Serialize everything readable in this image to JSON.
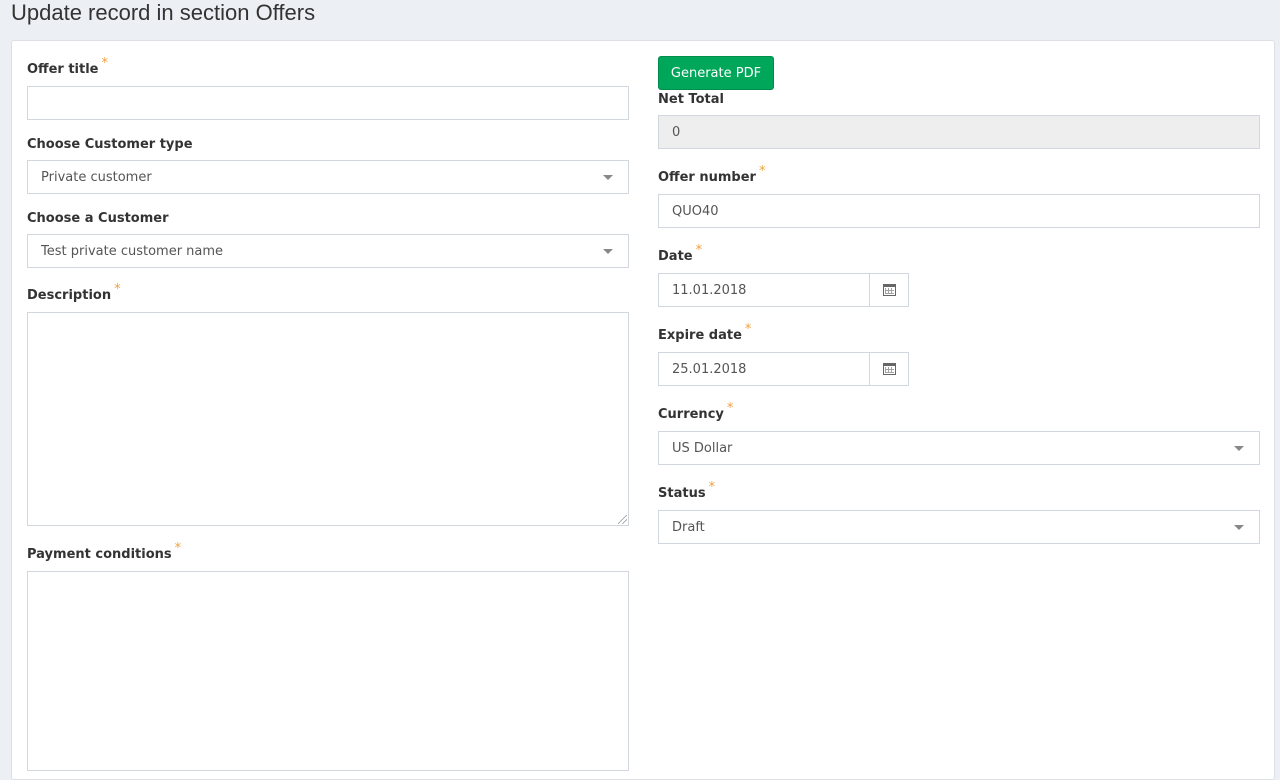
{
  "page": {
    "title": "Update record in section Offers"
  },
  "left": {
    "offer_title": {
      "label": "Offer title",
      "required": "*",
      "value": ""
    },
    "customer_type": {
      "label": "Choose Customer type",
      "value": "Private customer"
    },
    "customer": {
      "label": "Choose a Customer",
      "value": "Test private customer name"
    },
    "description": {
      "label": "Description",
      "required": "*",
      "value": ""
    },
    "payment_conditions": {
      "label": "Payment conditions",
      "required": "*",
      "value": ""
    }
  },
  "right": {
    "generate_pdf_label": "Generate PDF",
    "net_total": {
      "label": "Net Total",
      "value": "0"
    },
    "offer_number": {
      "label": "Offer number",
      "required": "*",
      "value": "QUO40"
    },
    "date": {
      "label": "Date",
      "required": "*",
      "value": "11.01.2018"
    },
    "expire_date": {
      "label": "Expire date",
      "required": "*",
      "value": "25.01.2018"
    },
    "currency": {
      "label": "Currency",
      "required": "*",
      "value": "US Dollar"
    },
    "status": {
      "label": "Status",
      "required": "*",
      "value": "Draft"
    }
  },
  "colors": {
    "accent_green": "#00a65a",
    "required_star": "#f0a040",
    "background": "#ecf0f5"
  }
}
